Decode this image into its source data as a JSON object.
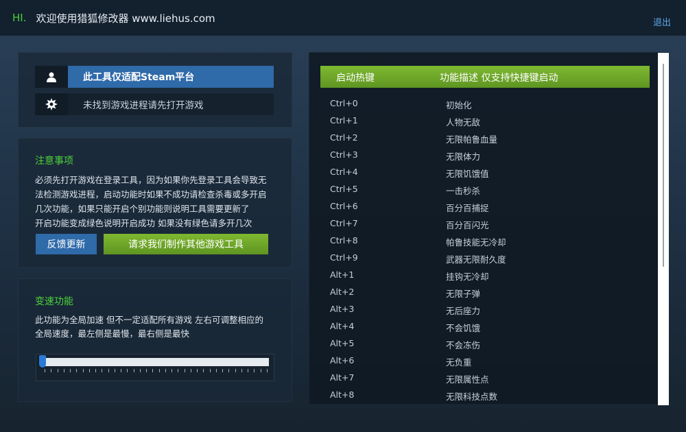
{
  "header": {
    "hi": "HI.",
    "welcome": "欢迎使用猎狐修改器 www.liehus.com",
    "logout": "退出"
  },
  "status_panel": {
    "platform_text": "此工具仅适配Steam平台",
    "status_text": "未找到游戏进程请先打开游戏",
    "icons": [
      "user-icon",
      "gear-icon"
    ]
  },
  "notice": {
    "title": "注意事项",
    "lines": [
      "必须先打开游戏在登录工具，因为如果你先登录工具会导致无",
      "法检测游戏进程，启动功能时如果不成功请检查杀毒或多开启",
      "几次功能，如果只能开启个别功能则说明工具需要更新了",
      "开启功能变成绿色说明开启成功 如果没有绿色请多开几次"
    ],
    "feedback_button": "反馈更新",
    "request_button": "请求我们制作其他游戏工具"
  },
  "speed": {
    "title": "变速功能",
    "lines": [
      "此功能为全局加速 但不一定适配所有游戏 左右可调整相应的",
      "全局速度，最左侧是最慢，最右侧是最快"
    ],
    "slider_value": 0
  },
  "hotkeys": {
    "col_key": "启动热键",
    "col_desc": "功能描述 仅支持快捷键启动",
    "rows": [
      {
        "key": "Ctrl+0",
        "desc": "初始化"
      },
      {
        "key": "Ctrl+1",
        "desc": "人物无敌"
      },
      {
        "key": "Ctrl+2",
        "desc": "无限帕鲁血量"
      },
      {
        "key": "Ctrl+3",
        "desc": "无限体力"
      },
      {
        "key": "Ctrl+4",
        "desc": "无限饥饿值"
      },
      {
        "key": "Ctrl+5",
        "desc": "一击秒杀"
      },
      {
        "key": "Ctrl+6",
        "desc": "百分百捕捉"
      },
      {
        "key": "Ctrl+7",
        "desc": "百分百闪光"
      },
      {
        "key": "Ctrl+8",
        "desc": "帕鲁技能无冷却"
      },
      {
        "key": "Ctrl+9",
        "desc": "武器无限耐久度"
      },
      {
        "key": "Alt+1",
        "desc": "挂钩无冷却"
      },
      {
        "key": "Alt+2",
        "desc": "无限子弹"
      },
      {
        "key": "Alt+3",
        "desc": "无后座力"
      },
      {
        "key": "Alt+4",
        "desc": "不会饥饿"
      },
      {
        "key": "Alt+5",
        "desc": "不会冻伤"
      },
      {
        "key": "Alt+6",
        "desc": "无负重"
      },
      {
        "key": "Alt+7",
        "desc": "无限属性点"
      },
      {
        "key": "Alt+8",
        "desc": "无限科技点数"
      }
    ]
  },
  "colors": {
    "accent_green": "#4cd13a",
    "button_blue": "#2f6aa9",
    "header_green": "#6fa829",
    "link_blue": "#5fa8e8"
  }
}
